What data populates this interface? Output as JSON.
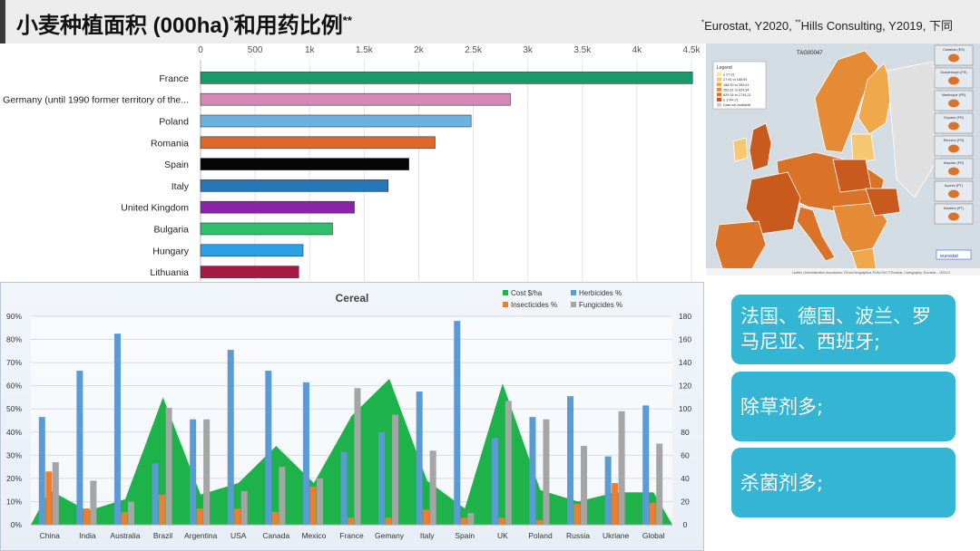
{
  "header": {
    "title": "小麦种植面积 (000ha)",
    "title_mark_1": "*",
    "title_suffix": "和用药比例",
    "title_mark_2": "**",
    "source_mark_1": "*",
    "source_part_1": "Eurostat, Y2020, ",
    "source_mark_2": "**",
    "source_part_2": "Hills Consulting, Y2019, 下同"
  },
  "map": {
    "code_label": "TAG00047",
    "legend_title": "Legend",
    "legend_items": [
      "≤ 27.91",
      "27.91 to 188.90",
      "188.90 to 359.61",
      "359.61 to 629.34",
      "629.34 to 1744.21",
      "≥ 1744.21",
      "Data not available"
    ],
    "inset_labels": [
      "Canarias (ES)",
      "Guadeloupe (FR)",
      "Martinique (FR)",
      "Guyane (FR)",
      "Réunion (FR)",
      "Mayotte (FR)",
      "Açores (PT)",
      "Madeira (PT)"
    ],
    "attribution": "Leaflet | Administrative boundaries: ©EuroGeographics ©UN-FAO ©Turkstat, Cartography: Eurostat – GISCO",
    "logo_text": "eurostat",
    "colors": [
      "#fbe3b0",
      "#f6c874",
      "#efa84a",
      "#e58a35",
      "#da7328",
      "#c85a1e",
      "#cccccc"
    ]
  },
  "callouts": [
    "法国、德国、波兰、罗马尼亚、西班牙;",
    "除草剂多;",
    "杀菌剂多;"
  ],
  "chart_data": [
    {
      "type": "bar",
      "orientation": "horizontal",
      "categories": [
        "France",
        "Germany (until 1990 former territory of the...",
        "Poland",
        "Romania",
        "Spain",
        "Italy",
        "United Kingdom",
        "Bulgaria",
        "Hungary",
        "Lithuania"
      ],
      "values": [
        4510,
        2840,
        2480,
        2150,
        1910,
        1720,
        1410,
        1210,
        940,
        900
      ],
      "colors": [
        "#1a9a6b",
        "#d488b5",
        "#6cb2e0",
        "#e0672a",
        "#050505",
        "#2774b6",
        "#8a24a6",
        "#2ebf6a",
        "#2aa0e6",
        "#a81845"
      ],
      "xlim": [
        0,
        4500
      ],
      "xticks": [
        "0",
        "500",
        "1k",
        "1.5k",
        "2k",
        "2.5k",
        "3k",
        "3.5k",
        "4k",
        "4.5k"
      ]
    },
    {
      "type": "bar",
      "title": "Cereal",
      "categories": [
        "China",
        "India",
        "Australia",
        "Brazil",
        "Argentina",
        "USA",
        "Canada",
        "Mexico",
        "France",
        "Gemany",
        "Italy",
        "Spain",
        "UK",
        "Poland",
        "Russia",
        "Ukriane",
        "Global"
      ],
      "ylim_left": [
        0,
        90
      ],
      "yticks_left": [
        "0%",
        "10%",
        "20%",
        "30%",
        "40%",
        "50%",
        "60%",
        "70%",
        "80%",
        "90%"
      ],
      "ylim_right": [
        0,
        180
      ],
      "yticks_right": [
        "0",
        "20",
        "40",
        "60",
        "80",
        "100",
        "120",
        "140",
        "160",
        "180"
      ],
      "area_series": {
        "name": "Cost $/ha",
        "color": "#1db24a",
        "axis": "right",
        "values": [
          30,
          12,
          22,
          110,
          26,
          36,
          68,
          36,
          94,
          126,
          38,
          14,
          122,
          30,
          20,
          28,
          28
        ]
      },
      "series": [
        {
          "name": "Herbicides %",
          "color": "#5b9bd5",
          "values": [
            46.5,
            66.5,
            82.5,
            26.5,
            45.5,
            75.5,
            66.5,
            61.5,
            31.5,
            40,
            57.5,
            88,
            37.5,
            46.5,
            55.5,
            29.5,
            51.5
          ]
        },
        {
          "name": "Insecticides %",
          "color": "#ed7d31",
          "values": [
            23,
            7,
            5.5,
            13,
            7,
            7,
            5.5,
            16.5,
            3,
            3,
            6.5,
            3,
            3,
            2,
            9,
            18,
            9.5
          ]
        },
        {
          "name": "Fungicides %",
          "color": "#a5a5a5",
          "values": [
            27,
            19,
            10,
            50.5,
            45.5,
            14.5,
            25,
            20,
            59,
            47.5,
            32,
            5,
            53.5,
            45.5,
            34,
            49,
            35
          ]
        }
      ],
      "legend_position": "top-right"
    }
  ]
}
